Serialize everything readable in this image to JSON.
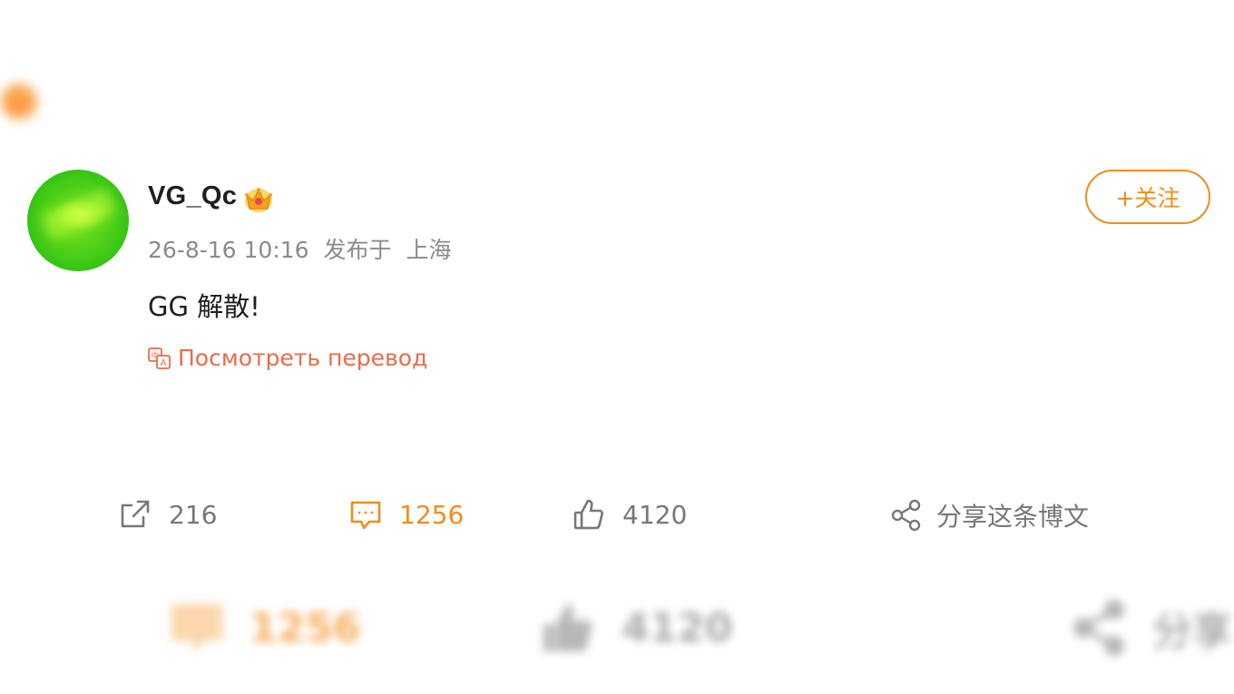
{
  "colors": {
    "accent": "#f28c1b",
    "translate": "#ea6b47",
    "text": "#1f1f1f",
    "muted": "#8b8b8b"
  },
  "post": {
    "username": "VG_Qc",
    "badge_icon": "crown-icon",
    "date": "26-8-16 10:16",
    "published_at": "发布于",
    "location": "上海",
    "content": "GG 解散!",
    "translate_label": "Посмотреть перевод",
    "follow_label": "+关注"
  },
  "actions": {
    "repost": {
      "icon": "repost-icon",
      "count": "216"
    },
    "comment": {
      "icon": "comment-icon",
      "count": "1256"
    },
    "like": {
      "icon": "thumbs-up-icon",
      "count": "4120"
    },
    "share": {
      "icon": "share-icon",
      "label": "分享这条博文"
    }
  },
  "blurred_actions": {
    "comment_count": "1256",
    "like_count": "4120",
    "share_label": "分享"
  }
}
